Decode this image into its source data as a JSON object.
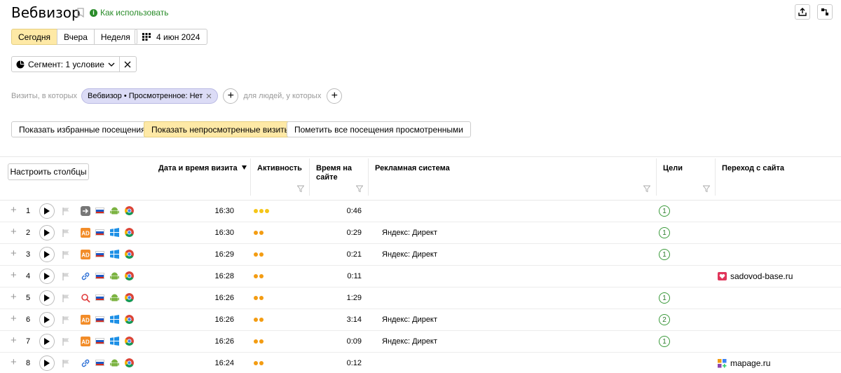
{
  "header": {
    "title": "Вебвизор",
    "how_to_use": "Как использовать"
  },
  "period": {
    "tabs": [
      "Сегодня",
      "Вчера",
      "Неделя"
    ],
    "active": "Сегодня",
    "date": "4 июн 2024"
  },
  "segment": {
    "label": "Сегмент: 1 условие"
  },
  "filter": {
    "visits_prefix": "Визиты, в которых",
    "chip": "Вебвизор • Просмотренное: Нет",
    "people_prefix": "для людей, у которых"
  },
  "actions": {
    "favorites": "Показать избранные посещения",
    "unviewed": "Показать непросмотренные визиты",
    "mark_all": "Пометить все посещения просмотренными"
  },
  "table": {
    "configure_columns": "Настроить столбцы",
    "columns": {
      "datetime": "Дата и время визита",
      "activity": "Активность",
      "duration": "Время на сайте",
      "adsystem": "Рекламная система",
      "goals": "Цели",
      "referrer": "Переход с сайта"
    },
    "rows": [
      {
        "num": "1",
        "source": "direct-icon",
        "os": "android",
        "time": "16:30",
        "activity": 3,
        "duration": "0:46",
        "ad": "",
        "goals": "1",
        "ref": ""
      },
      {
        "num": "2",
        "source": "ad-icon",
        "os": "windows",
        "time": "16:30",
        "activity": 2,
        "duration": "0:29",
        "ad": "Яндекс: Директ",
        "goals": "1",
        "ref": ""
      },
      {
        "num": "3",
        "source": "ad-icon",
        "os": "windows",
        "time": "16:29",
        "activity": 2,
        "duration": "0:21",
        "ad": "Яндекс: Директ",
        "goals": "1",
        "ref": ""
      },
      {
        "num": "4",
        "source": "link-icon",
        "os": "android",
        "time": "16:28",
        "activity": 2,
        "duration": "0:11",
        "ad": "",
        "goals": "",
        "ref": "sadovod-base.ru",
        "ref_icon": "heart"
      },
      {
        "num": "5",
        "source": "search-icon",
        "os": "android",
        "time": "16:26",
        "activity": 2,
        "duration": "1:29",
        "ad": "",
        "goals": "1",
        "ref": ""
      },
      {
        "num": "6",
        "source": "ad-icon",
        "os": "windows",
        "time": "16:26",
        "activity": 2,
        "duration": "3:14",
        "ad": "Яндекс: Директ",
        "goals": "2",
        "ref": ""
      },
      {
        "num": "7",
        "source": "ad-icon",
        "os": "windows",
        "time": "16:26",
        "activity": 2,
        "duration": "0:09",
        "ad": "Яндекс: Директ",
        "goals": "1",
        "ref": ""
      },
      {
        "num": "8",
        "source": "link-icon",
        "os": "android",
        "time": "16:24",
        "activity": 2,
        "duration": "0:12",
        "ad": "",
        "goals": "",
        "ref": "mapage.ru",
        "ref_icon": "grid"
      }
    ]
  },
  "colors": {
    "accent_yellow": "#fee9a6",
    "link_green": "#2a8c2a",
    "activity_yellow": "#f5c518",
    "activity_orange": "#f39c12",
    "ad_orange": "#f28c28"
  }
}
